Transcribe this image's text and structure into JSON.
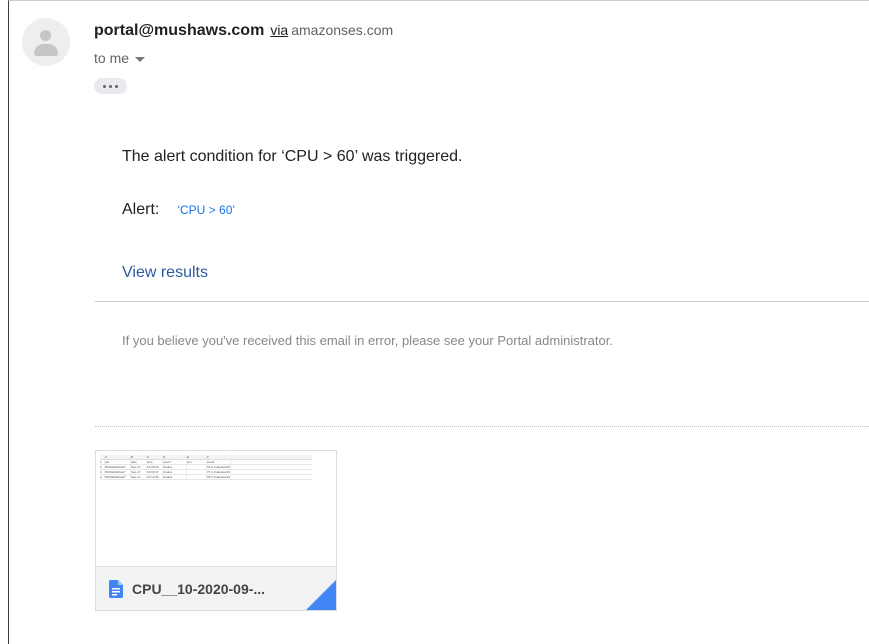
{
  "email": {
    "sender_address": "portal@mushaws.com",
    "via_label": "via",
    "via_domain": "amazonses.com",
    "recipient_label": "to me",
    "alert_sentence": "The alert condition for ‘CPU > 60’  was triggered.",
    "alert_label": "Alert:",
    "alert_value": "‘CPU > 60’",
    "view_results_label": "View results",
    "disclaimer": "If you believe you've received this email in error, please see your Portal administrator."
  },
  "attachment": {
    "file_name": "CPU__10-2020-09-...",
    "icon": "doc-icon",
    "preview_header": [
      "",
      "A",
      "B",
      "C",
      "D",
      "E",
      "F"
    ],
    "preview_columns": [
      "",
      "uid",
      "date",
      "time",
      "report",
      "cpu",
      "email"
    ],
    "preview_rows": [
      [
        "2",
        "5063a6b4fca27",
        "Sep-17",
        "10:09:36",
        "chakra",
        "",
        "52.9  chakravarthi@gm"
      ],
      [
        "3",
        "5063a6b4fca27",
        "Sep-17",
        "10:09:37",
        "chakra",
        "",
        "77.1  chakravarthi@gm"
      ],
      [
        "4",
        "5063a6b4fca27",
        "Sep-17",
        "10:12:36",
        "chakra",
        "",
        "55.3  chakravarthi@gm"
      ]
    ]
  },
  "colors": {
    "link": "#1a73e8",
    "view_results": "#2c5aa0",
    "attachment_corner": "#4285f4"
  }
}
